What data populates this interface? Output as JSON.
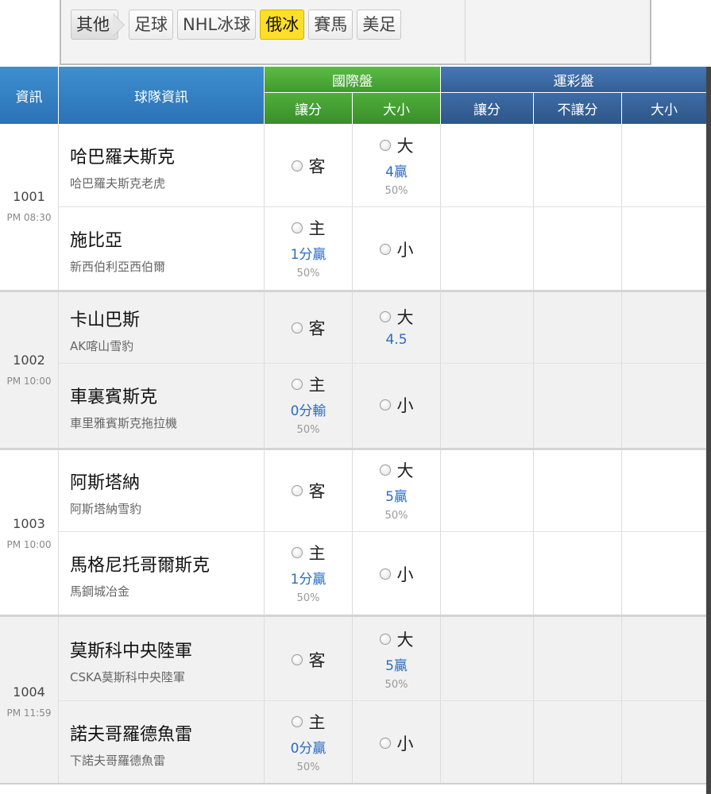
{
  "tabs": [
    {
      "label": "其他",
      "state": "back"
    },
    {
      "label": "足球",
      "state": "normal"
    },
    {
      "label": "NHL冰球",
      "state": "normal"
    },
    {
      "label": "俄冰",
      "state": "active"
    },
    {
      "label": "賽馬",
      "state": "normal"
    },
    {
      "label": "美足",
      "state": "normal"
    }
  ],
  "header": {
    "info": "資訊",
    "team_info": "球隊資訊",
    "intl": "國際盤",
    "intl_spread": "讓分",
    "intl_total": "大小",
    "sport": "運彩盤",
    "sport_spread": "讓分",
    "sport_moneyline": "不讓分",
    "sport_total": "大小"
  },
  "colors": {
    "header_blue": "#2b72b6",
    "header_green": "#3f9a2e",
    "header_dark_blue": "#335e96",
    "active_tab": "#ffde2a",
    "value_blue": "#2b6cc4"
  },
  "games": [
    {
      "id": "1001",
      "time": "PM 08:30",
      "away": {
        "name": "哈巴羅夫斯克",
        "full": "哈巴羅夫斯克老虎",
        "spread_label": "客",
        "total_label": "大",
        "total_val": "4贏",
        "total_pct": "50%"
      },
      "home": {
        "name": "施比亞",
        "full": "新西伯利亞西伯爾",
        "spread_label": "主",
        "spread_val": "1分贏",
        "spread_pct": "50%",
        "total_label": "小"
      }
    },
    {
      "id": "1002",
      "time": "PM 10:00",
      "away": {
        "name": "卡山巴斯",
        "full": "AK喀山雪豹",
        "spread_label": "客",
        "total_label": "大",
        "total_val": "4.5",
        "total_pct": ""
      },
      "home": {
        "name": "車裏賓斯克",
        "full": "車里雅賓斯克拖拉機",
        "spread_label": "主",
        "spread_val": "0分輸",
        "spread_pct": "50%",
        "total_label": "小"
      }
    },
    {
      "id": "1003",
      "time": "PM 10:00",
      "away": {
        "name": "阿斯塔納",
        "full": "阿斯塔納雪豹",
        "spread_label": "客",
        "total_label": "大",
        "total_val": "5贏",
        "total_pct": "50%"
      },
      "home": {
        "name": "馬格尼托哥爾斯克",
        "full": "馬鋼城冶金",
        "spread_label": "主",
        "spread_val": "1分贏",
        "spread_pct": "50%",
        "total_label": "小"
      }
    },
    {
      "id": "1004",
      "time": "PM 11:59",
      "away": {
        "name": "莫斯科中央陸軍",
        "full": "CSKA莫斯科中央陸軍",
        "spread_label": "客",
        "total_label": "大",
        "total_val": "5贏",
        "total_pct": "50%"
      },
      "home": {
        "name": "諾夫哥羅德魚雷",
        "full": "下諾夫哥羅德魚雷",
        "spread_label": "主",
        "spread_val": "0分贏",
        "spread_pct": "50%",
        "total_label": "小"
      }
    }
  ]
}
